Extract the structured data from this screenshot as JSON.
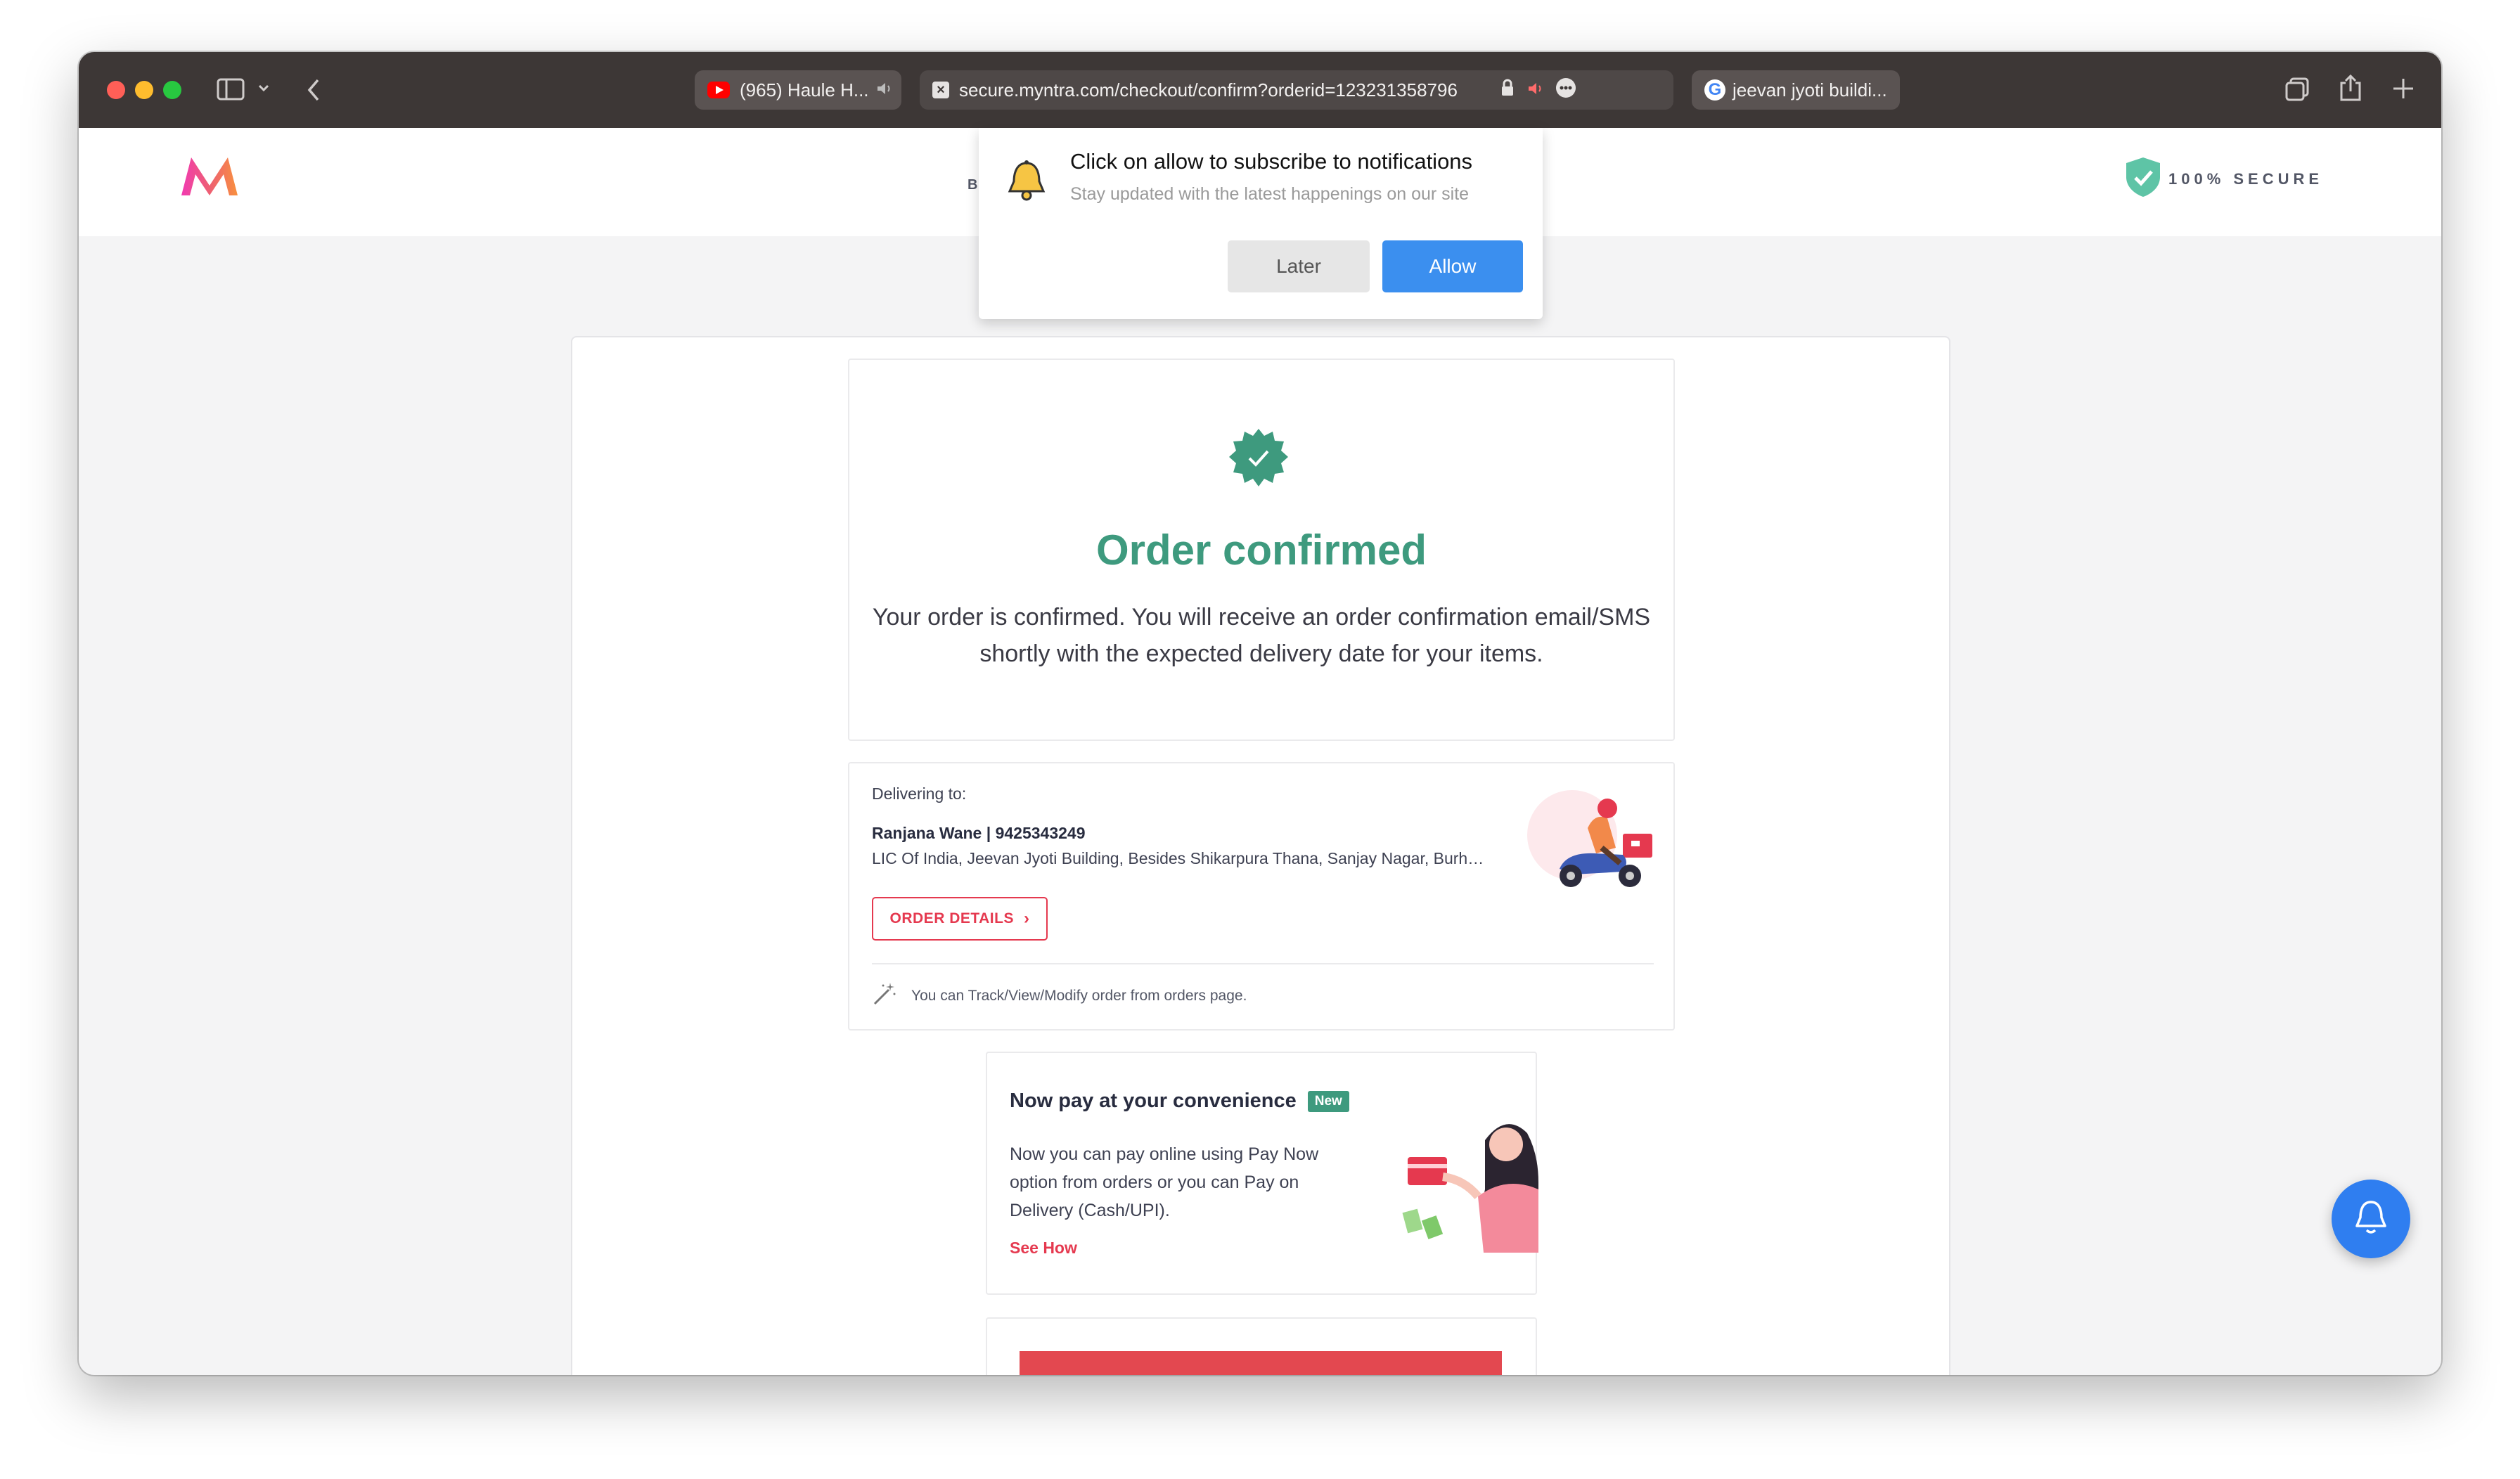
{
  "browser": {
    "tabs": [
      {
        "label": "(965) Haule H...",
        "icon": "youtube-icon"
      },
      {
        "label": "secure.myntra.com/checkout/confirm?orderid=123231358796",
        "icon": "close-icon"
      },
      {
        "label": "jeevan jyoti buildi...",
        "icon": "google-icon"
      }
    ]
  },
  "header": {
    "secure_label": "100% SECURE",
    "partial_letter": "B"
  },
  "notification": {
    "title": "Click on allow to subscribe to notifications",
    "subtitle": "Stay updated with the latest happenings on our site",
    "later_label": "Later",
    "allow_label": "Allow"
  },
  "confirmation": {
    "title": "Order confirmed",
    "message": "Your order is confirmed. You will receive an order confirmation email/SMS shortly with the expected delivery date for your items."
  },
  "delivery": {
    "label": "Delivering to:",
    "name_phone": "Ranjana Wane | 9425343249",
    "address": "LIC Of India, Jeevan Jyoti Building, Besides Shikarpura Thana, Sanjay Nagar, Burh…",
    "order_details_label": "ORDER DETAILS",
    "track_note": "You can Track/View/Modify order from orders page."
  },
  "pay_later": {
    "title": "Now pay at your convenience",
    "badge": "New",
    "text": "Now you can pay online using Pay Now option from orders or you can Pay on Delivery (Cash/UPI).",
    "link": "See How"
  },
  "colors": {
    "accent_green": "#3e9a7e",
    "brand_pink": "#e5394f",
    "allow_blue": "#3b8fef"
  }
}
